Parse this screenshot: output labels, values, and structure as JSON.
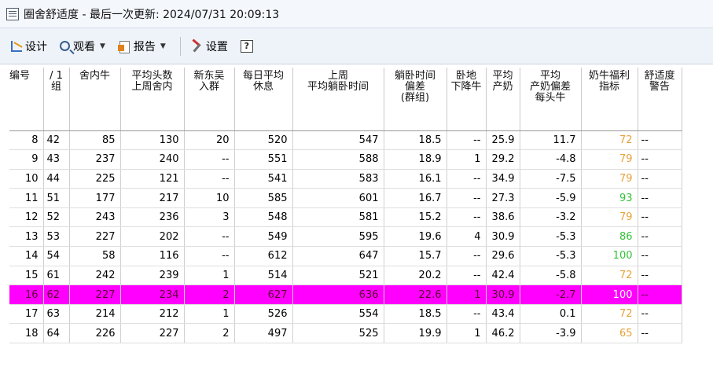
{
  "window": {
    "title": "圈舍舒适度 - 最后一次更新: 2024/07/31 20:09:13",
    "icon": "document-icon"
  },
  "toolbar": {
    "design_label": "设计",
    "view_label": "观看",
    "report_label": "报告",
    "settings_label": "设置",
    "help_label": "?"
  },
  "table": {
    "columns": [
      "编号",
      "/ 1\n组",
      "舍内牛",
      "平均头数\n上周舍内",
      "新东吴\n入群",
      "每日平均\n休息",
      "上周\n平均躺卧时间",
      "躺卧时间\n偏差\n(群组)",
      "卧地\n下降牛",
      "平均\n产奶",
      "平均\n产奶偏差\n每头牛",
      "奶牛福利\n指标",
      "舒适度\n警告"
    ],
    "rows": [
      {
        "c": [
          "8",
          "42",
          "85",
          "130",
          "20",
          "520",
          "547",
          "18.5",
          "--",
          "25.9",
          "11.7",
          "72",
          "--"
        ],
        "welfare_color": "orange",
        "highlight": false
      },
      {
        "c": [
          "9",
          "43",
          "237",
          "240",
          "--",
          "551",
          "588",
          "18.9",
          "1",
          "29.2",
          "-4.8",
          "79",
          "--"
        ],
        "welfare_color": "orange",
        "highlight": false
      },
      {
        "c": [
          "10",
          "44",
          "225",
          "121",
          "--",
          "541",
          "583",
          "16.1",
          "--",
          "34.9",
          "-7.5",
          "79",
          "--"
        ],
        "welfare_color": "orange",
        "highlight": false
      },
      {
        "c": [
          "11",
          "51",
          "177",
          "217",
          "10",
          "585",
          "601",
          "16.7",
          "--",
          "27.3",
          "-5.9",
          "93",
          "--"
        ],
        "welfare_color": "green",
        "highlight": false
      },
      {
        "c": [
          "12",
          "52",
          "243",
          "236",
          "3",
          "548",
          "581",
          "15.2",
          "--",
          "38.6",
          "-3.2",
          "79",
          "--"
        ],
        "welfare_color": "orange",
        "highlight": false
      },
      {
        "c": [
          "13",
          "53",
          "227",
          "202",
          "--",
          "549",
          "595",
          "19.6",
          "4",
          "30.9",
          "-5.3",
          "86",
          "--"
        ],
        "welfare_color": "green",
        "highlight": false
      },
      {
        "c": [
          "14",
          "54",
          "58",
          "116",
          "--",
          "612",
          "647",
          "15.7",
          "--",
          "29.6",
          "-5.3",
          "100",
          "--"
        ],
        "welfare_color": "green",
        "highlight": false
      },
      {
        "c": [
          "15",
          "61",
          "242",
          "239",
          "1",
          "514",
          "521",
          "20.2",
          "--",
          "42.4",
          "-5.8",
          "72",
          "--"
        ],
        "welfare_color": "orange",
        "highlight": false
      },
      {
        "c": [
          "16",
          "62",
          "227",
          "234",
          "2",
          "627",
          "636",
          "22.6",
          "1",
          "30.9",
          "-2.7",
          "100",
          "--"
        ],
        "welfare_color": "green",
        "highlight": true
      },
      {
        "c": [
          "17",
          "63",
          "214",
          "212",
          "1",
          "526",
          "554",
          "18.5",
          "--",
          "43.4",
          "0.1",
          "72",
          "--"
        ],
        "welfare_color": "orange",
        "highlight": false
      },
      {
        "c": [
          "18",
          "64",
          "226",
          "227",
          "2",
          "497",
          "525",
          "19.9",
          "1",
          "46.2",
          "-3.9",
          "65",
          "--"
        ],
        "welfare_color": "orange",
        "highlight": false
      }
    ]
  },
  "colors": {
    "highlight_row": "#ff00ff",
    "welfare_orange": "#e8a23a",
    "welfare_green": "#34c23a"
  }
}
